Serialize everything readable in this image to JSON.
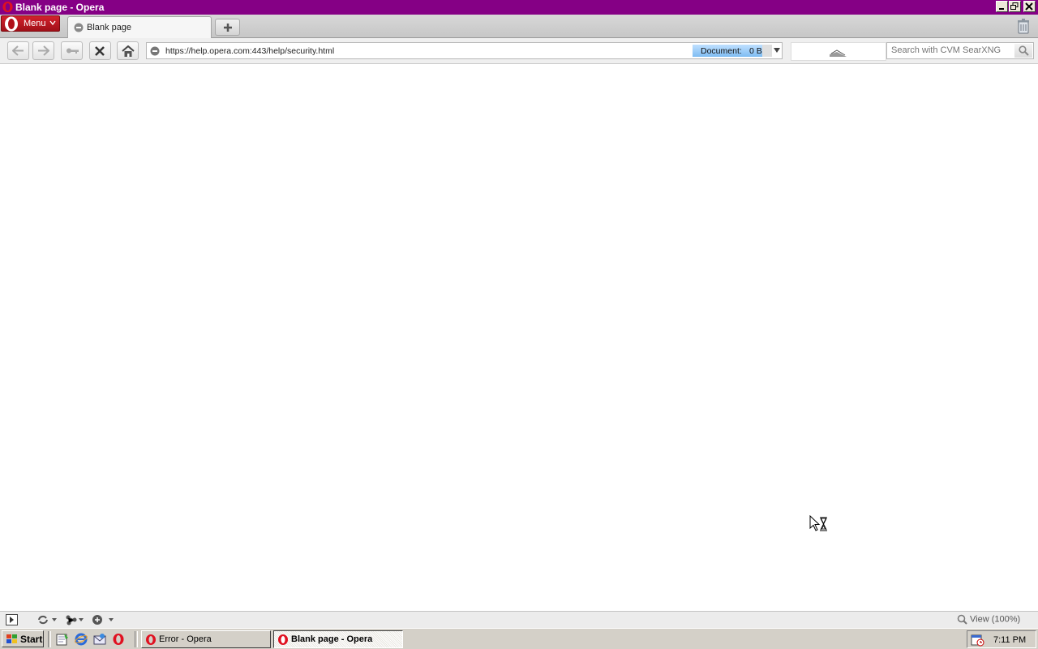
{
  "window": {
    "title": "Blank page - Opera"
  },
  "tabs": {
    "menu_label": "Menu",
    "active_tab_label": "Blank page"
  },
  "address_bar": {
    "url": "https://help.opera.com:443/help/security.html",
    "progress_label": "Document:",
    "progress_value": "0 B",
    "progress_fraction": 0.88
  },
  "search": {
    "placeholder": "Search with CVM SearXNG"
  },
  "status_bar": {
    "zoom_label": "View (100%)"
  },
  "taskbar": {
    "start_label": "Start",
    "tasks": [
      {
        "label": "Error - Opera"
      },
      {
        "label": "Blank page - Opera"
      }
    ],
    "clock": "7:11 PM"
  },
  "icons": {
    "browser": "opera-icon",
    "cursor": "busy-cursor-icon"
  },
  "colors": {
    "title_bar": "#850085",
    "menu_button": "#c0151f"
  }
}
